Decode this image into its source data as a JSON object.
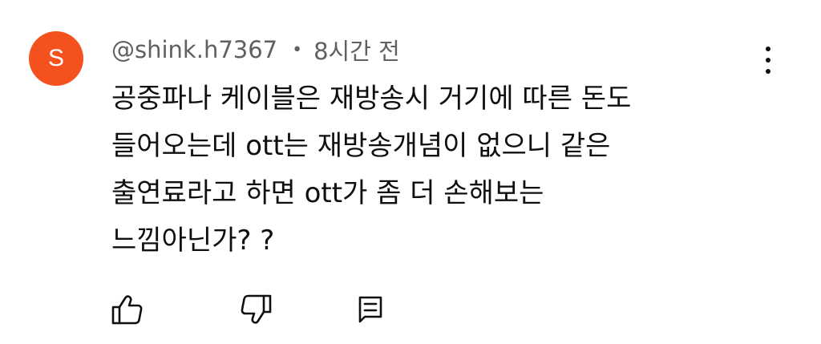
{
  "comment": {
    "avatar_letter": "S",
    "avatar_color": "#f4511e",
    "author": "@shink.h7367",
    "separator": "•",
    "timestamp": "8시간 전",
    "lines": [
      "공중파나 케이블은 재방송시 거기에 따른 돈도",
      "들어오는데 ott는 재방송개념이 없으니 같은",
      "출연료라고 하면 ott가 좀 더 손해보는",
      "느낌아닌가? ?"
    ]
  },
  "actions": {
    "like_icon": "thumbs-up-icon",
    "dislike_icon": "thumbs-down-icon",
    "reply_icon": "reply-comment-icon",
    "menu_icon": "more-vertical-icon"
  }
}
